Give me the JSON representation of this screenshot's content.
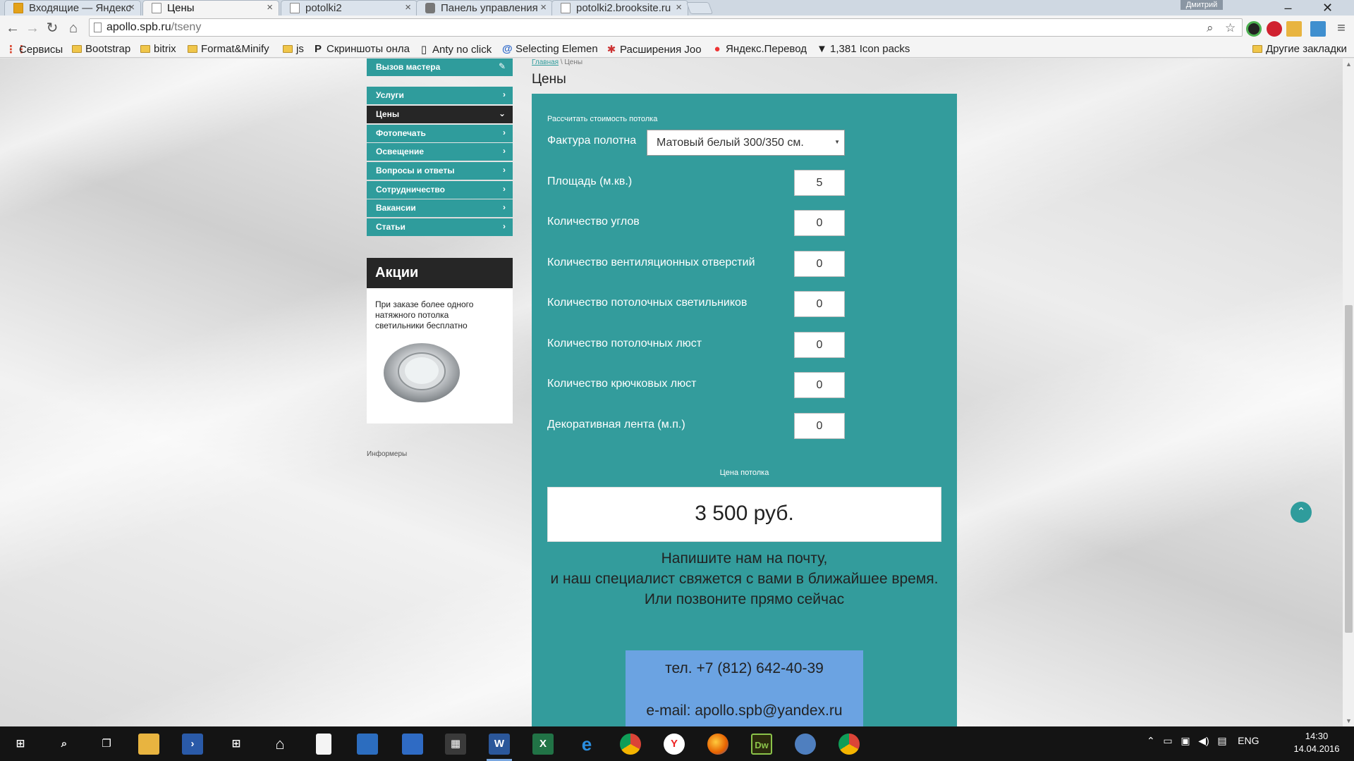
{
  "browser": {
    "tabs": [
      {
        "title": "Входящие — Яндекс",
        "icon": "mail-icon",
        "active": false
      },
      {
        "title": "Цены",
        "icon": "page-icon",
        "active": true
      },
      {
        "title": "potolki2",
        "icon": "page-icon",
        "active": false
      },
      {
        "title": "Панель управления",
        "icon": "game-icon",
        "active": false
      },
      {
        "title": "potolki2.brooksite.ru",
        "icon": "page-icon",
        "active": false
      }
    ],
    "user": "Дмитрий",
    "url_host": "apollo.spb.ru",
    "url_path": "/tseny",
    "bookmarks": [
      {
        "label": "Сервисы",
        "icon": "apps-grid-icon"
      },
      {
        "label": "Bootstrap",
        "icon": "folder-icon"
      },
      {
        "label": "bitrix",
        "icon": "folder-icon"
      },
      {
        "label": "Format&Minify",
        "icon": "folder-icon"
      },
      {
        "label": "js",
        "icon": "folder-icon"
      },
      {
        "label": "Скриншоты онла",
        "icon": "p-letter-icon"
      },
      {
        "label": "Anty no click",
        "icon": "page-icon"
      },
      {
        "label": "Selecting Element",
        "icon": "swirl-icon"
      },
      {
        "label": "Расширения Joo",
        "icon": "joomla-icon"
      },
      {
        "label": "Яндекс.Перевод",
        "icon": "yandex-icon"
      },
      {
        "label": "1,381 Icon packs",
        "icon": "funnel-icon"
      }
    ],
    "other_bookmarks": "Другие закладки"
  },
  "sidebar": {
    "call_master": "Вызов мастера",
    "menu": [
      {
        "label": "Услуги",
        "active": false
      },
      {
        "label": "Цены",
        "active": true
      },
      {
        "label": "Фотопечать",
        "active": false
      },
      {
        "label": "Освещение",
        "active": false
      },
      {
        "label": "Вопросы и ответы",
        "active": false
      },
      {
        "label": "Сотрудничество",
        "active": false
      },
      {
        "label": "Вакансии",
        "active": false
      },
      {
        "label": "Статьи",
        "active": false
      }
    ],
    "promo_title": "Акции",
    "promo_text": "При заказе более одного натяжного потолка светильники бесплатно",
    "informers": "Информеры"
  },
  "main": {
    "breadcrumb_home": "Главная",
    "breadcrumb_current": "Цены",
    "title": "Цены",
    "calc_caption": "Рассчитать стоимость потолка",
    "texture_label": "Фактура полотна",
    "texture_value": "Матовый белый 300/350 см.",
    "rows": [
      {
        "label": "Площадь (м.кв.)",
        "value": "5"
      },
      {
        "label": "Количество углов",
        "value": "0"
      },
      {
        "label": "Количество вентиляционных отверстий",
        "value": "0"
      },
      {
        "label": "Количество потолочных светильников",
        "value": "0"
      },
      {
        "label": "Количество потолочных люст",
        "value": "0"
      },
      {
        "label": "Количество крючковых люст",
        "value": "0"
      },
      {
        "label": "Декоративная лента (м.п.)",
        "value": "0"
      }
    ],
    "price_caption": "Цена потолка",
    "price": "3 500 руб.",
    "contact_lines": [
      "Напишите нам на почту,",
      "и наш специалист свяжется с вами в ближайшее время.",
      "Или позвоните прямо сейчас"
    ],
    "phone": "тел. +7 (812) 642-40-39",
    "email": "e-mail: apollo.spb@yandex.ru"
  },
  "taskbar": {
    "apps": [
      {
        "name": "start-icon"
      },
      {
        "name": "search-icon"
      },
      {
        "name": "task-view-icon"
      },
      {
        "name": "file-explorer-icon"
      },
      {
        "name": "powershell-icon"
      },
      {
        "name": "store-icon"
      },
      {
        "name": "home-icon"
      },
      {
        "name": "document-icon"
      },
      {
        "name": "remote-desktop-icon"
      },
      {
        "name": "notepad-icon"
      },
      {
        "name": "calculator-icon"
      },
      {
        "name": "word-icon",
        "label": "W"
      },
      {
        "name": "excel-icon",
        "label": "X"
      },
      {
        "name": "edge-icon",
        "label": "e"
      },
      {
        "name": "chrome-icon"
      },
      {
        "name": "yandex-browser-icon",
        "label": "Y"
      },
      {
        "name": "firefox-icon"
      },
      {
        "name": "dreamweaver-icon",
        "label": "Dw"
      },
      {
        "name": "thunderbird-icon"
      },
      {
        "name": "chrome-active-icon"
      }
    ],
    "language": "ENG",
    "time": "14:30",
    "date": "14.04.2016"
  }
}
